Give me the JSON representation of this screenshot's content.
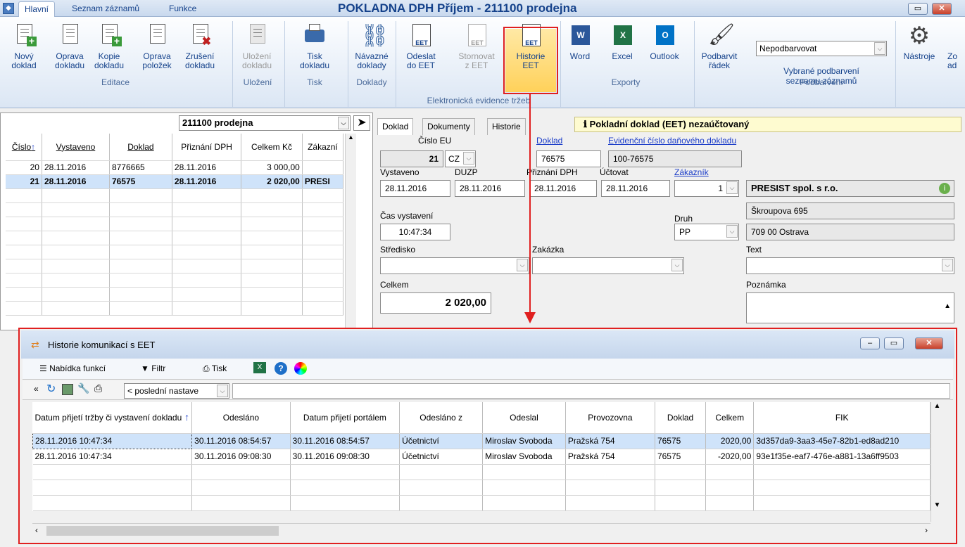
{
  "ribbon": {
    "tabs": [
      "Hlavní",
      "Seznam záznamů",
      "Funkce"
    ],
    "title": "POKLADNA DPH Příjem - 211100  prodejna",
    "buttons": [
      {
        "l1": "Nový",
        "l2": "doklad"
      },
      {
        "l1": "Oprava",
        "l2": "dokladu"
      },
      {
        "l1": "Kopie",
        "l2": "dokladu"
      },
      {
        "l1": "Oprava",
        "l2": "položek"
      },
      {
        "l1": "Zrušení",
        "l2": "dokladu"
      },
      {
        "l1": "Uložení",
        "l2": "dokladu"
      },
      {
        "l1": "Tisk",
        "l2": "dokladu"
      },
      {
        "l1": "Návazné",
        "l2": "doklady"
      },
      {
        "l1": "Odeslat",
        "l2": "do EET"
      },
      {
        "l1": "Stornovat",
        "l2": "z EET"
      },
      {
        "l1": "Historie",
        "l2": "EET"
      },
      {
        "l1": "Word",
        "l2": ""
      },
      {
        "l1": "Excel",
        "l2": ""
      },
      {
        "l1": "Outlook",
        "l2": ""
      },
      {
        "l1": "Podbarvit",
        "l2": "řádek"
      },
      {
        "l1": "Nástroje",
        "l2": ""
      },
      {
        "l1": "Zo",
        "l2": "ad"
      }
    ],
    "groups": [
      "Editace",
      "Uložení",
      "Tisk",
      "Doklady",
      "Elektronická evidence tržeb",
      "Exporty",
      "Podbarvení"
    ],
    "color_select": "Nepodbarvovat",
    "color_label1": "Vybrané podbarvení",
    "color_label2": "seznamu záznamů"
  },
  "left": {
    "combo": "211100  prodejna",
    "headers": [
      "Číslo",
      "Vystaveno",
      "Doklad",
      "Přiznání DPH",
      "Celkem Kč",
      "Zákazní"
    ],
    "rows": [
      [
        "20",
        "28.11.2016",
        "8776665",
        "28.11.2016",
        "3 000,00",
        ""
      ],
      [
        "21",
        "28.11.2016",
        "76575",
        "28.11.2016",
        "2 020,00",
        "PRESI"
      ]
    ]
  },
  "form": {
    "tabs": [
      "Doklad",
      "Dokumenty",
      "Historie"
    ],
    "status": "Pokladní doklad (EET) nezaúčtovaný",
    "cislo_eu_label": "Číslo EU",
    "cislo": "21",
    "country": "CZ",
    "doklad_label": "Doklad",
    "doklad": "76575",
    "evid_label": "Evidenční číslo daňového dokladu",
    "evid": "100-76575",
    "vystaveno_label": "Vystaveno",
    "duzp_label": "DUZP",
    "priznani_label": "Přiznání DPH",
    "uctovat_label": "Účtovat",
    "zakaznik_label": "Zákazník",
    "vystaveno": "28.11.2016",
    "duzp": "28.11.2016",
    "priznani": "28.11.2016",
    "uctovat": "28.11.2016",
    "zak_num": "1",
    "customer": "PRESIST spol. s r.o.",
    "street": "Škroupova 695",
    "city": "709 00 Ostrava",
    "cas_label": "Čas vystavení",
    "cas": "10:47:34",
    "druh_label": "Druh",
    "druh": "PP",
    "stredisko_label": "Středisko",
    "zakazka_label": "Zakázka",
    "text_label": "Text",
    "celkem_label": "Celkem",
    "celkem": "2 020,00",
    "poznamka_label": "Poznámka"
  },
  "history": {
    "title": "Historie komunikací s EET",
    "toolbar": [
      "Nabídka funkcí",
      "Filtr",
      "Tisk"
    ],
    "setting": "< poslední nastave",
    "headers": [
      "Datum přijetí tržby či vystavení dokladu",
      "Odesláno",
      "Datum přijetí portálem",
      "Odesláno z",
      "Odeslal",
      "Provozovna",
      "Doklad",
      "Celkem",
      "FIK"
    ],
    "rows": [
      [
        "28.11.2016 10:47:34",
        "30.11.2016 08:54:57",
        "30.11.2016 08:54:57",
        "Účetnictví",
        "Miroslav Svoboda",
        "Pražská 754",
        "76575",
        "2020,00",
        "3d357da9-3aa3-45e7-82b1-ed8ad210"
      ],
      [
        "28.11.2016 10:47:34",
        "30.11.2016 09:08:30",
        "30.11.2016 09:08:30",
        "Účetnictví",
        "Miroslav Svoboda",
        "Pražská 754",
        "76575",
        "-2020,00",
        "93e1f35e-eaf7-476e-a881-13a6ff9503"
      ]
    ]
  }
}
